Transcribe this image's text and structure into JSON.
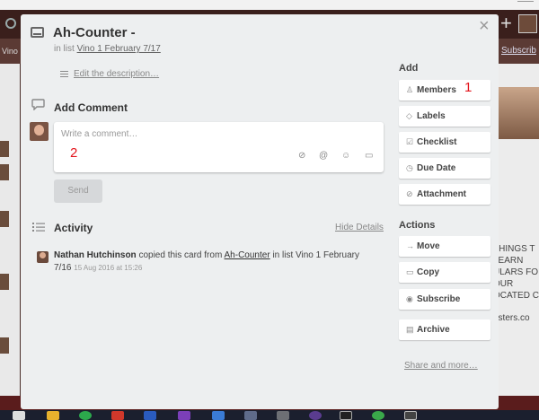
{
  "background": {
    "board_sub_left": "Vino M",
    "board_sub_right": "Subscrib",
    "right_text_lines": [
      "THINGS T",
      "LEARN",
      "ULARS FO",
      "OUR",
      "OCATED C"
    ],
    "right_site": "asters.co"
  },
  "card": {
    "title": "Ah-Counter -",
    "in_list_prefix": "in list",
    "list_name": "Vino 1 February 7/17",
    "edit_description": "Edit the description…",
    "close_glyph": "×"
  },
  "comment": {
    "heading": "Add Comment",
    "placeholder": "Write a comment…",
    "send_label": "Send",
    "icons": [
      "attach-icon",
      "mention-icon",
      "emoji-icon",
      "card-icon"
    ]
  },
  "activity": {
    "heading": "Activity",
    "hide_details": "Hide Details",
    "entry": {
      "user": "Nathan Hutchinson",
      "text_before_link": "copied this card from",
      "link": "Ah-Counter",
      "text_after_link": "in list Vino 1 February 7/16",
      "date": "15 Aug 2016 at 15:26"
    }
  },
  "sidebar": {
    "add_heading": "Add",
    "add_buttons": [
      {
        "label": "Members",
        "icon": "person-icon"
      },
      {
        "label": "Labels",
        "icon": "tag-icon"
      },
      {
        "label": "Checklist",
        "icon": "checkbox-icon"
      },
      {
        "label": "Due Date",
        "icon": "clock-icon"
      },
      {
        "label": "Attachment",
        "icon": "paperclip-icon"
      }
    ],
    "actions_heading": "Actions",
    "action_buttons": [
      {
        "label": "Move",
        "icon": "arrow-right-icon"
      },
      {
        "label": "Copy",
        "icon": "card-icon"
      },
      {
        "label": "Subscribe",
        "icon": "eye-icon"
      },
      {
        "label": "Archive",
        "icon": "archive-icon"
      }
    ],
    "share": "Share and more…"
  },
  "annotations": {
    "one": "1",
    "two": "2"
  },
  "colors": {
    "accent_annotation": "#e3131b",
    "modal_bg": "#edeff0"
  }
}
